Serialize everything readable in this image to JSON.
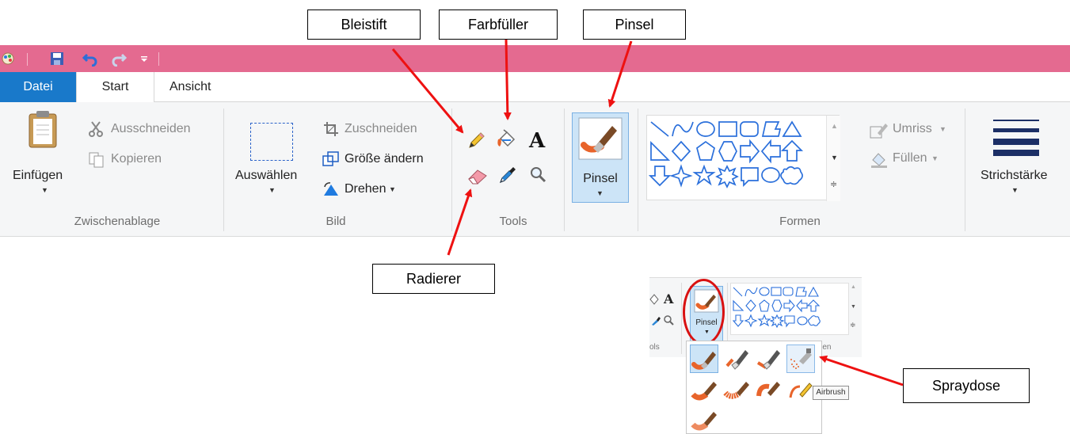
{
  "annotations": {
    "bleistift": "Bleistift",
    "farbfueller": "Farbfüller",
    "pinsel": "Pinsel",
    "radierer": "Radierer",
    "spraydose": "Spraydose"
  },
  "tabs": {
    "file": "Datei",
    "start": "Start",
    "view": "Ansicht"
  },
  "clipboard": {
    "paste": "Einfügen",
    "cut": "Ausschneiden",
    "copy": "Kopieren",
    "group": "Zwischenablage"
  },
  "image": {
    "select": "Auswählen",
    "crop": "Zuschneiden",
    "resize": "Größe ändern",
    "rotate": "Drehen",
    "group": "Bild"
  },
  "tools": {
    "group": "Tools",
    "text_glyph": "A"
  },
  "brushes": {
    "label": "Pinsel"
  },
  "shapes": {
    "outline": "Umriss",
    "fill": "Füllen",
    "group": "Formen"
  },
  "stroke": {
    "label": "Strichstärke"
  },
  "popup": {
    "brush_label": "Pinsel",
    "tools_partial": "ols",
    "shapes_partial": "men",
    "text_glyph": "A",
    "tooltip": "Airbrush"
  },
  "colors": {
    "titlebar": "#e46a90",
    "file_tab": "#1979ca",
    "arrow": "#ee1111",
    "brush_orange": "#e8642b"
  }
}
